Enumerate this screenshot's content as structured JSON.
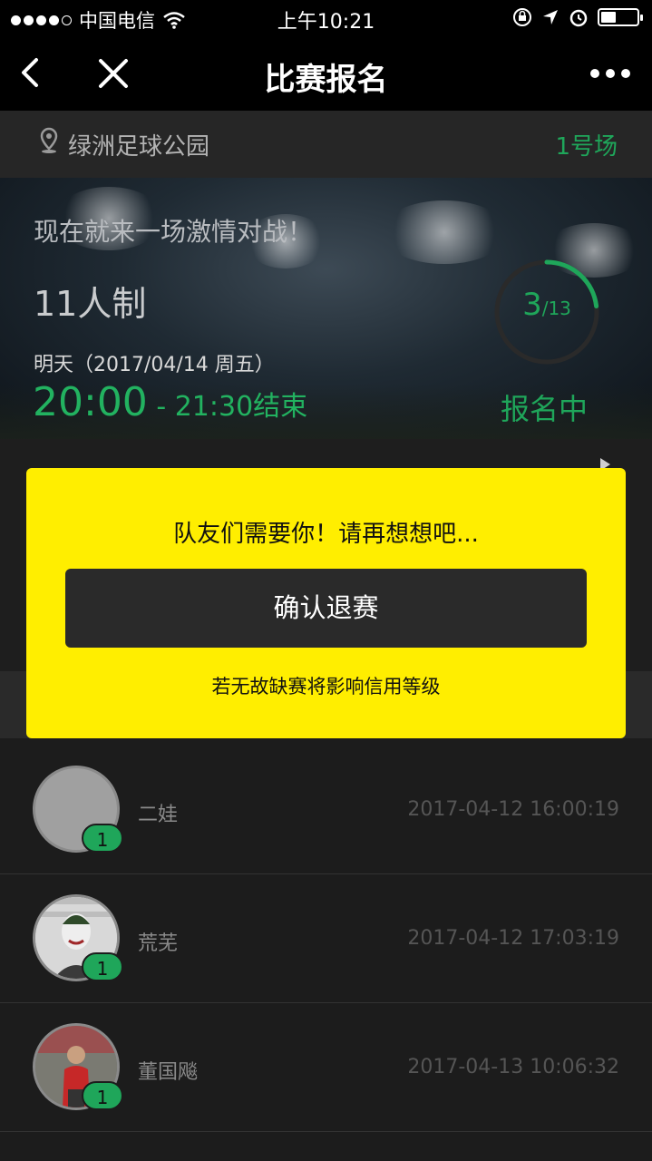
{
  "status_bar": {
    "carrier": "中国电信",
    "time": "上午10:21"
  },
  "nav": {
    "title": "比赛报名"
  },
  "venue": {
    "name": "绿洲足球公园",
    "field": "1号场"
  },
  "match": {
    "slogan": "现在就来一场激情对战！",
    "format": "11人制",
    "date": "明天（2017/04/14 周五）",
    "start_time": "20:00",
    "end_time": " - 21:30结束",
    "registered": "3",
    "capacity": "/13",
    "registered_count": 3,
    "capacity_count": 13,
    "status": "报名中"
  },
  "modal": {
    "message": "队友们需要你！请再想想吧...",
    "confirm_label": "确认退赛",
    "note": "若无故缺赛将影响信用等级"
  },
  "players": [
    {
      "name": "二娃",
      "time": "2017-04-12 16:00:19",
      "badge": "1"
    },
    {
      "name": "荒芜",
      "time": "2017-04-12 17:03:19",
      "badge": "1"
    },
    {
      "name": "董国飚",
      "time": "2017-04-13 10:06:32",
      "badge": "1"
    }
  ],
  "colors": {
    "accent_green": "#1fa65a",
    "modal_yellow": "#ffee00"
  }
}
